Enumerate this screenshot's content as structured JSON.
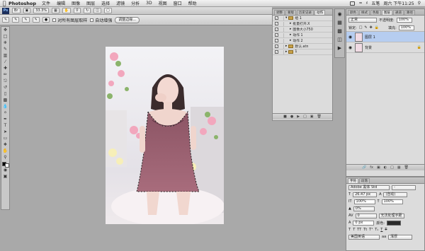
{
  "menubar": {
    "app_name": "Photoshop",
    "menu": [
      "文件",
      "编辑",
      "图像",
      "图层",
      "选择",
      "滤镜",
      "分析",
      "3D",
      "视图",
      "窗口",
      "帮助"
    ],
    "day_of_week": "五笔",
    "clock": "周六 下午11:25",
    "search_icon": "magnifier"
  },
  "appbar": {
    "ps_badge": "Ps",
    "zoom": "33.3%"
  },
  "options": {
    "sample_all_layers": "对所有图层取样",
    "auto_enhance": "自动增强",
    "refine_edge_button": "调整边缘..."
  },
  "toolbox": {
    "icons": [
      "move",
      "marquee",
      "lasso",
      "quick-select",
      "crop",
      "eyedropper",
      "healing",
      "brush",
      "stamp",
      "history-brush",
      "eraser",
      "gradient",
      "blur",
      "dodge",
      "pen",
      "type",
      "path-select",
      "shape",
      "hand",
      "zoom"
    ]
  },
  "actions_panel": {
    "tabs": [
      "调整",
      "蒙版",
      "历史记录",
      "动作"
    ],
    "active_tab": "动作",
    "rows": [
      {
        "label": "组 1",
        "kind": "folder",
        "level": 0
      },
      {
        "label": "批量打开.X",
        "kind": "action",
        "level": 1
      },
      {
        "label": "图像大小750",
        "kind": "action",
        "level": 1
      },
      {
        "label": "动作 1",
        "kind": "action",
        "level": 1
      },
      {
        "label": "动作 2",
        "kind": "action",
        "level": 1
      },
      {
        "label": "默认.atn",
        "kind": "folder",
        "level": 0
      },
      {
        "label": "1",
        "kind": "folder",
        "level": 0
      }
    ]
  },
  "layers_panel": {
    "tabs": [
      "图层",
      "通道",
      "路径",
      "颜色",
      "样式",
      "色板"
    ],
    "active_tab": "图层",
    "blend_mode": "正常",
    "opacity_label": "不透明度:",
    "opacity_value": "100%",
    "lock_label": "锁定:",
    "fill_label": "填充:",
    "fill_value": "100%",
    "layers": [
      {
        "name": "图层 1",
        "selected": true
      },
      {
        "name": "背景",
        "selected": false
      }
    ]
  },
  "character_panel": {
    "tabs": [
      "字符",
      "段落"
    ],
    "font_family": "Adobe 黑体 Std",
    "font_style": "-",
    "font_size": "26.47 px",
    "leading": "(自动)",
    "vertical_scale": "100%",
    "horizontal_scale": "100%",
    "kerning": "0%",
    "tracking": "0",
    "tsume": "无法处理字距",
    "baseline": "0 px",
    "color_label": "颜色:",
    "language": "美国英语",
    "antialias": "浑厚"
  },
  "colors": {
    "accent": "#3d6fd1",
    "selected_layer": "#b6cdf0"
  }
}
